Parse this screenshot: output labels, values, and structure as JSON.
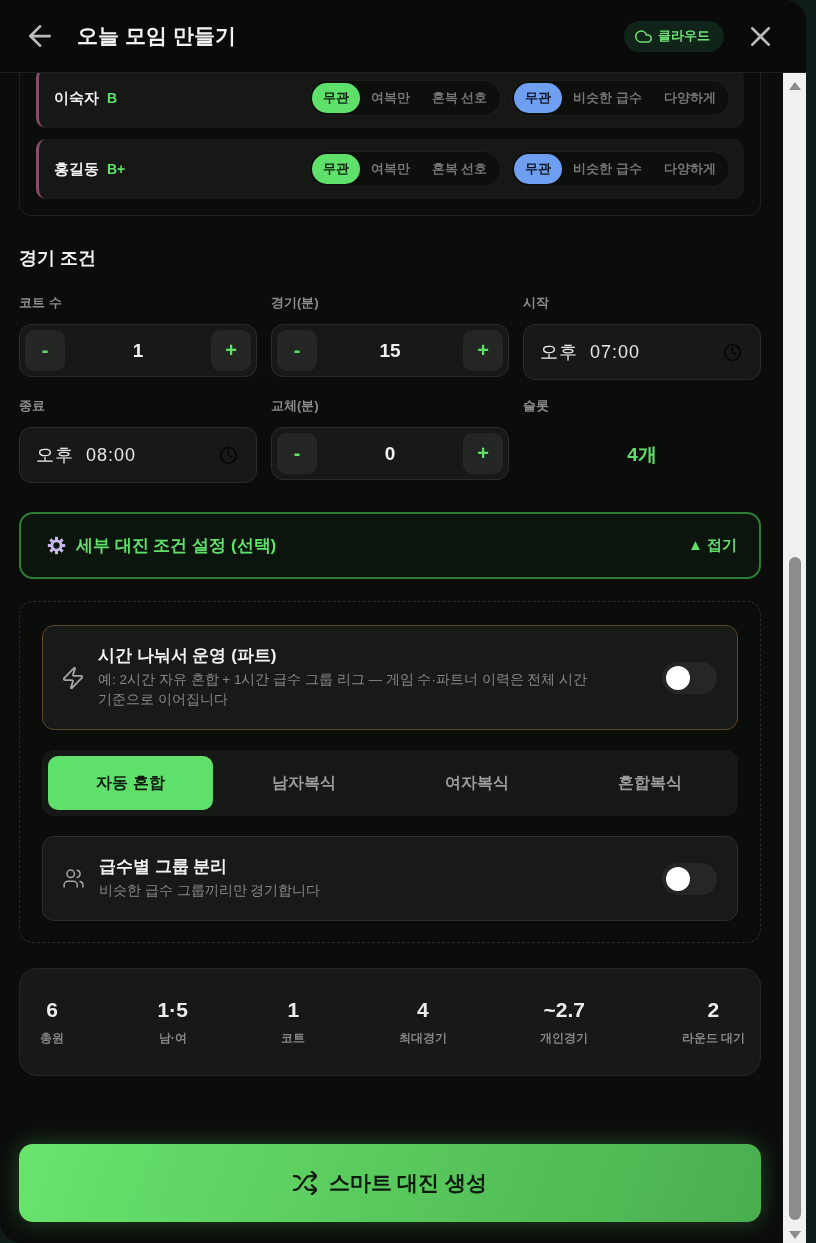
{
  "header": {
    "title": "오늘 모임 만들기",
    "badge": "클라우드"
  },
  "players": [
    {
      "name": "이숙자",
      "grade": "B",
      "pairing": [
        {
          "label": "무관",
          "selected": true
        },
        {
          "label": "여복만",
          "selected": false
        },
        {
          "label": "혼복 선호",
          "selected": false
        }
      ],
      "level_mix": [
        {
          "label": "무관",
          "selected": true
        },
        {
          "label": "비슷한 급수",
          "selected": false
        },
        {
          "label": "다양하게",
          "selected": false
        }
      ]
    },
    {
      "name": "홍길동",
      "grade": "B+",
      "pairing": [
        {
          "label": "무관",
          "selected": true
        },
        {
          "label": "여복만",
          "selected": false
        },
        {
          "label": "혼복 선호",
          "selected": false
        }
      ],
      "level_mix": [
        {
          "label": "무관",
          "selected": true
        },
        {
          "label": "비슷한 급수",
          "selected": false
        },
        {
          "label": "다양하게",
          "selected": false
        }
      ]
    }
  ],
  "match_conditions": {
    "title": "경기 조건",
    "fields": [
      {
        "kind": "stepper",
        "label": "코트 수",
        "value": "1",
        "minus": "-",
        "plus": "+"
      },
      {
        "kind": "stepper",
        "label": "경기(분)",
        "value": "15",
        "minus": "-",
        "plus": "+"
      },
      {
        "kind": "time",
        "label": "시작",
        "value": "오후 07:00"
      },
      {
        "kind": "time",
        "label": "종료",
        "value": "오후 08:00"
      },
      {
        "kind": "stepper",
        "label": "교체(분)",
        "value": "0",
        "minus": "-",
        "plus": "+"
      },
      {
        "kind": "readout",
        "label": "슬롯",
        "value": "4개"
      }
    ]
  },
  "detail_settings": {
    "label": "세부 대진 조건 설정 (선택)",
    "toggle": "▲ 접기",
    "expanded": true,
    "part_mode": {
      "title": "시간 나눠서 운영 (파트)",
      "description": "예: 2시간 자유 혼합 + 1시간 급수 그룹 리그 — 게임 수·파트너 이력은 전체 시간 기준으로 이어집니다",
      "on": false
    },
    "match_types": [
      {
        "label": "자동 혼합",
        "selected": true
      },
      {
        "label": "남자복식",
        "selected": false
      },
      {
        "label": "여자복식",
        "selected": false
      },
      {
        "label": "혼합복식",
        "selected": false
      }
    ],
    "grade_split": {
      "title": "급수별 그룹 분리",
      "description": "비슷한 급수 그룹끼리만 경기합니다",
      "on": false
    }
  },
  "summary": [
    {
      "value": "6",
      "label": "총원"
    },
    {
      "value": "1·5",
      "label": "남·여"
    },
    {
      "value": "1",
      "label": "코트"
    },
    {
      "value": "4",
      "label": "최대경기"
    },
    {
      "value": "~2.7",
      "label": "개인경기"
    },
    {
      "value": "2",
      "label": "라운드 대기"
    }
  ],
  "generate_button": {
    "label": "스마트 대진 생성"
  }
}
